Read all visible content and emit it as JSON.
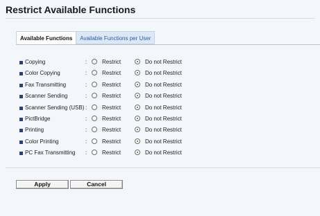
{
  "page": {
    "title": "Restrict Available Functions"
  },
  "tabs": [
    {
      "label": "Available Functions"
    },
    {
      "label": "Available Functions per User"
    }
  ],
  "options": {
    "restrict": "Restrict",
    "do_not_restrict": "Do not Restrict"
  },
  "separator": ":",
  "functions": [
    {
      "label": "Copying",
      "selected": "do_not_restrict"
    },
    {
      "label": "Color Copying",
      "selected": "do_not_restrict"
    },
    {
      "label": "Fax Transmitting",
      "selected": "do_not_restrict"
    },
    {
      "label": "Scanner Sending",
      "selected": "do_not_restrict"
    },
    {
      "label": "Scanner Sending (USB)",
      "selected": "do_not_restrict"
    },
    {
      "label": "PictBridge",
      "selected": "do_not_restrict"
    },
    {
      "label": "Printing",
      "selected": "do_not_restrict"
    },
    {
      "label": "Color Printing",
      "selected": "do_not_restrict"
    },
    {
      "label": "PC Fax Transmitting",
      "selected": "do_not_restrict"
    }
  ],
  "buttons": {
    "apply": "Apply",
    "cancel": "Cancel"
  }
}
